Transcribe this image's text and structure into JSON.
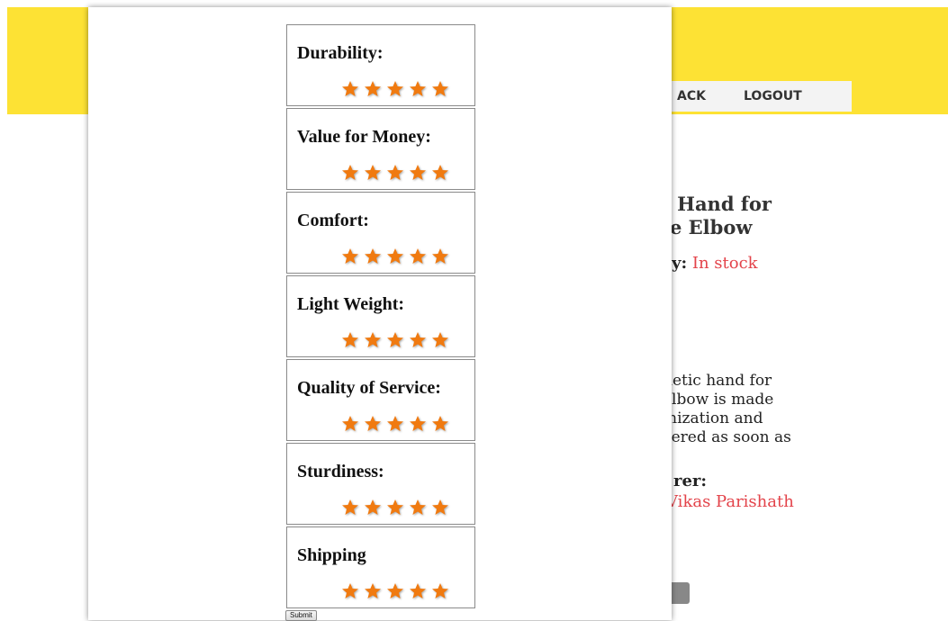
{
  "background_page": {
    "nav": {
      "back_label": "ACK",
      "logout_label": "LOGOUT"
    },
    "product": {
      "title_line1": "c Hand for",
      "title_line2": "e Elbow",
      "availability_label": "y:",
      "availability_value": "In stock",
      "description_lines": [
        "hetic hand for",
        "elbow is made",
        "mization and",
        "vered as soon as"
      ],
      "manufacturer_label": "rer:",
      "manufacturer_value": "Vikas Parishath"
    },
    "colors": {
      "header": "#fde234",
      "accent_text": "#e3434a"
    }
  },
  "rating_form": {
    "criteria": [
      {
        "label": "Durability:",
        "stars": 5
      },
      {
        "label": "Value for Money:",
        "stars": 5
      },
      {
        "label": "Comfort:",
        "stars": 5
      },
      {
        "label": "Light Weight:",
        "stars": 5
      },
      {
        "label": "Quality of Service:",
        "stars": 5
      },
      {
        "label": "Sturdiness:",
        "stars": 5
      },
      {
        "label": "Shipping",
        "stars": 5
      }
    ],
    "star_icon": "star-icon",
    "star_color": "#f07a10",
    "submit_label": "Submit"
  }
}
